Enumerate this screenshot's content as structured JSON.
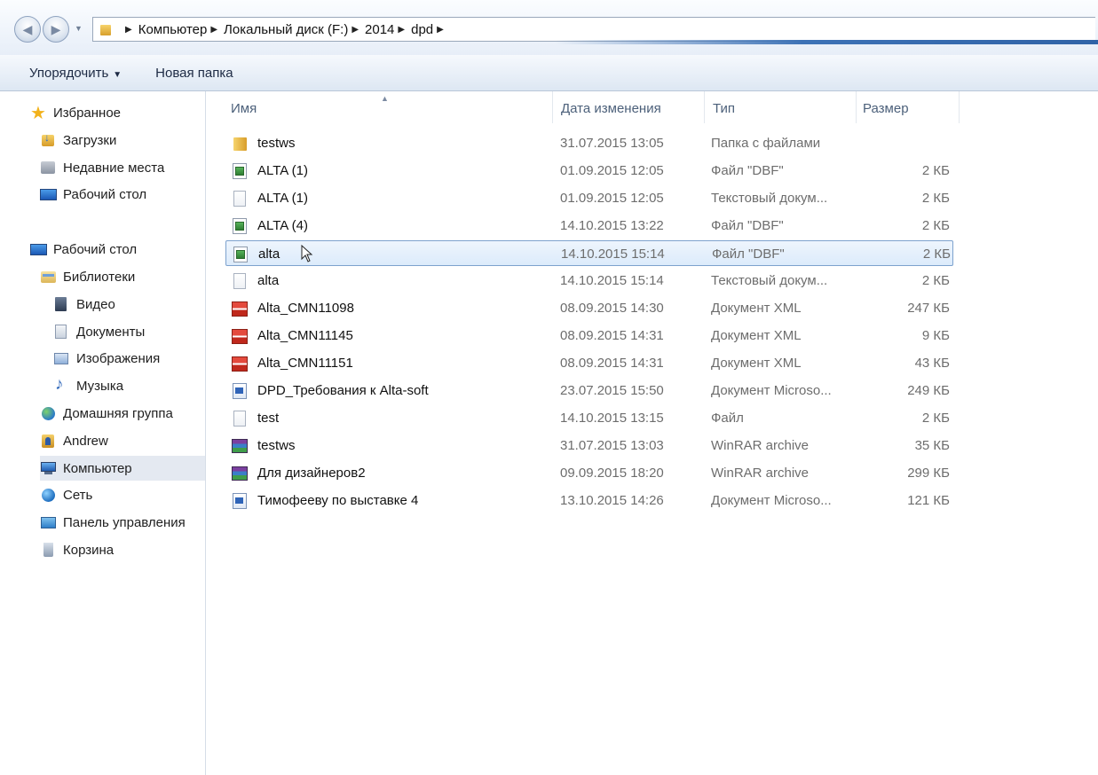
{
  "breadcrumb": [
    "Компьютер",
    "Локальный диск (F:)",
    "2014",
    "dpd"
  ],
  "toolbar": {
    "organize_label": "Упорядочить",
    "new_folder_label": "Новая папка"
  },
  "sidebar": {
    "items": [
      {
        "label": "Избранное",
        "icon": "star-icon"
      },
      {
        "label": "Загрузки",
        "icon": "downloads-folder-icon"
      },
      {
        "label": "Недавние места",
        "icon": "recent-places-icon"
      },
      {
        "label": "Рабочий стол",
        "icon": "desktop-icon"
      },
      {
        "label": "Рабочий стол",
        "icon": "desktop-icon"
      },
      {
        "label": "Библиотеки",
        "icon": "libraries-icon"
      },
      {
        "label": "Видео",
        "icon": "video-icon"
      },
      {
        "label": "Документы",
        "icon": "documents-icon"
      },
      {
        "label": "Изображения",
        "icon": "images-icon"
      },
      {
        "label": "Музыка",
        "icon": "music-icon"
      },
      {
        "label": "Домашняя группа",
        "icon": "homegroup-icon"
      },
      {
        "label": "Andrew",
        "icon": "user-folder-icon"
      },
      {
        "label": "Компьютер",
        "icon": "computer-icon"
      },
      {
        "label": "Сеть",
        "icon": "network-icon"
      },
      {
        "label": "Панель управления",
        "icon": "control-panel-icon"
      },
      {
        "label": "Корзина",
        "icon": "recycle-bin-icon"
      }
    ]
  },
  "columns": {
    "name": "Имя",
    "date": "Дата изменения",
    "type": "Тип",
    "size": "Размер"
  },
  "files": [
    {
      "name": "testws",
      "date": "31.07.2015 13:05",
      "type": "Папка с файлами",
      "size": "",
      "icon": "folder-icon"
    },
    {
      "name": "ALTA (1)",
      "date": "01.09.2015 12:05",
      "type": "Файл \"DBF\"",
      "size": "2 КБ",
      "icon": "dbf-file-icon"
    },
    {
      "name": "ALTA (1)",
      "date": "01.09.2015 12:05",
      "type": "Текстовый докум...",
      "size": "2 КБ",
      "icon": "text-file-icon"
    },
    {
      "name": "ALTA (4)",
      "date": "14.10.2015 13:22",
      "type": "Файл \"DBF\"",
      "size": "2 КБ",
      "icon": "dbf-file-icon"
    },
    {
      "name": "alta",
      "date": "14.10.2015 15:14",
      "type": "Файл \"DBF\"",
      "size": "2 КБ",
      "icon": "dbf-file-icon"
    },
    {
      "name": "alta",
      "date": "14.10.2015 15:14",
      "type": "Текстовый докум...",
      "size": "2 КБ",
      "icon": "text-file-icon"
    },
    {
      "name": "Alta_CMN11098",
      "date": "08.09.2015 14:30",
      "type": "Документ XML",
      "size": "247 КБ",
      "icon": "xml-file-icon"
    },
    {
      "name": "Alta_CMN11145",
      "date": "08.09.2015 14:31",
      "type": "Документ XML",
      "size": "9 КБ",
      "icon": "xml-file-icon"
    },
    {
      "name": "Alta_CMN11151",
      "date": "08.09.2015 14:31",
      "type": "Документ XML",
      "size": "43 КБ",
      "icon": "xml-file-icon"
    },
    {
      "name": "DPD_Требования к Alta-soft",
      "date": "23.07.2015 15:50",
      "type": "Документ Microso...",
      "size": "249 КБ",
      "icon": "word-document-icon"
    },
    {
      "name": "test",
      "date": "14.10.2015 13:15",
      "type": "Файл",
      "size": "2 КБ",
      "icon": "text-file-icon"
    },
    {
      "name": "testws",
      "date": "31.07.2015 13:03",
      "type": "WinRAR archive",
      "size": "35 КБ",
      "icon": "rar-archive-icon"
    },
    {
      "name": "Для дизайнеров2",
      "date": "09.09.2015 18:20",
      "type": "WinRAR archive",
      "size": "299 КБ",
      "icon": "rar-archive-icon"
    },
    {
      "name": "Тимофееву по выставке 4",
      "date": "13.10.2015 14:26",
      "type": "Документ Microso...",
      "size": "121 КБ",
      "icon": "word-document-icon"
    }
  ],
  "colors": {
    "selection_border": "#7da2ce",
    "selection_fill": "#dcebfb",
    "toolbar_text": "#1d2a44",
    "meta_text": "#6d6d6d"
  }
}
